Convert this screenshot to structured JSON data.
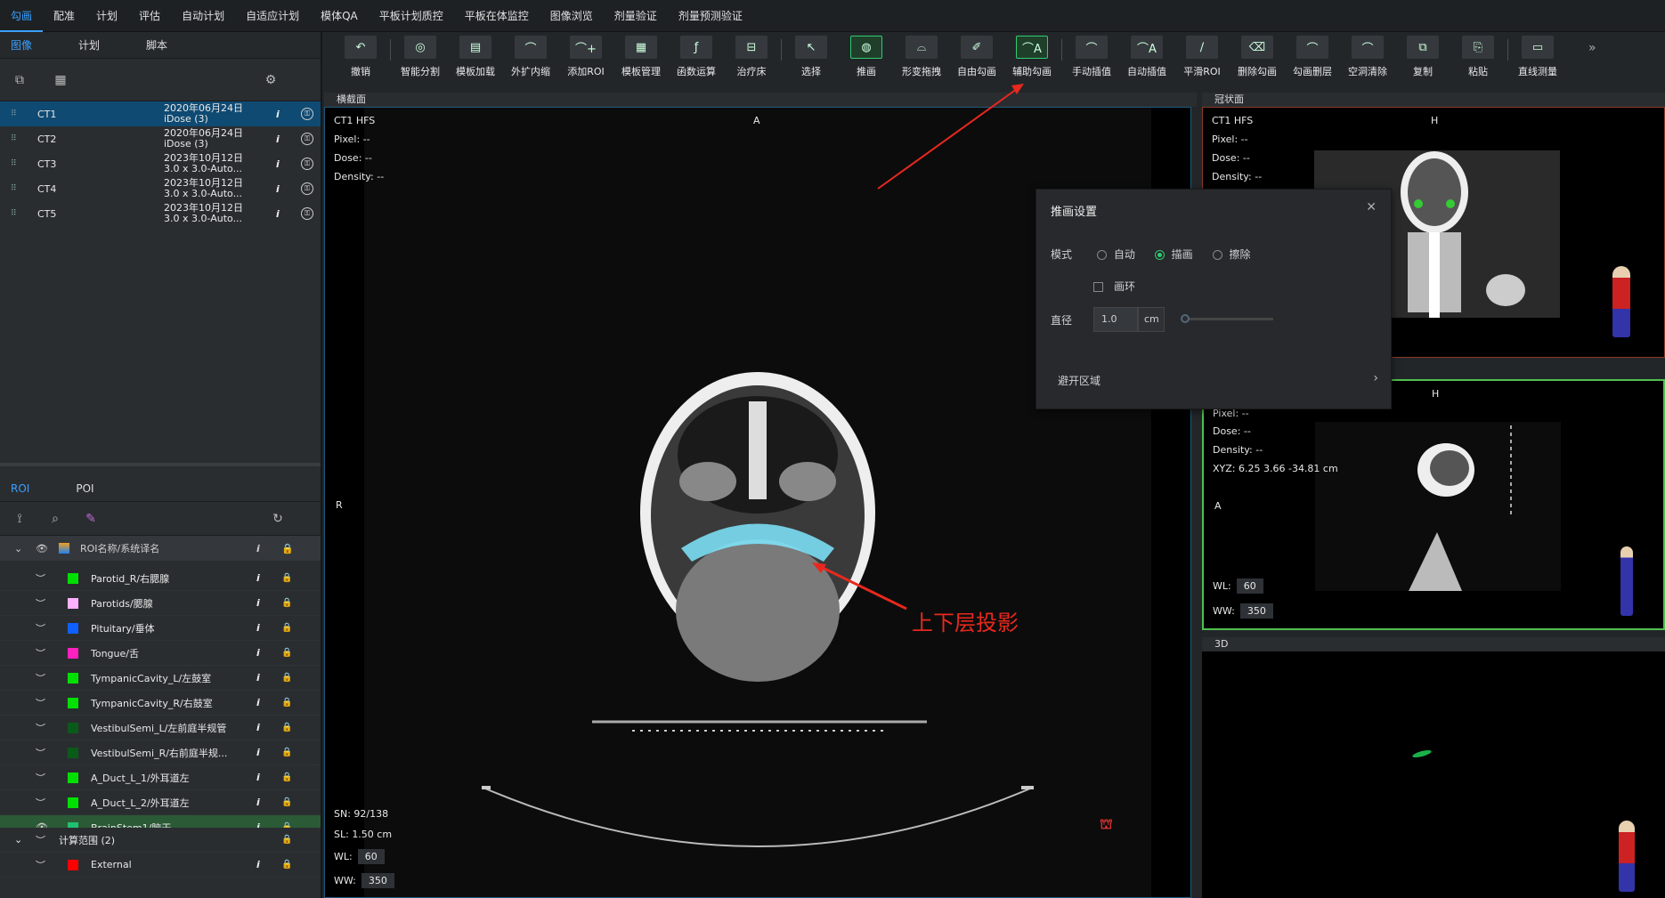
{
  "top_menu": [
    "勾画",
    "配准",
    "计划",
    "评估",
    "自动计划",
    "自适应计划",
    "模体QA",
    "平板计划质控",
    "平板在体监控",
    "图像浏览",
    "剂量验证",
    "剂量预测验证"
  ],
  "left": {
    "tabs": [
      "图像",
      "计划",
      "脚本"
    ],
    "images": [
      {
        "name": "CT1",
        "date": "2020年06月24日",
        "sub": "iDose (3)"
      },
      {
        "name": "CT2",
        "date": "2020年06月24日",
        "sub": "iDose (3)"
      },
      {
        "name": "CT3",
        "date": "2023年10月12日",
        "sub": "3.0 x 3.0-Auto..."
      },
      {
        "name": "CT4",
        "date": "2023年10月12日",
        "sub": "3.0 x 3.0-Auto..."
      },
      {
        "name": "CT5",
        "date": "2023年10月12日",
        "sub": "3.0 x 3.0-Auto..."
      }
    ],
    "info_glyph": "i",
    "roi_tabs": [
      "ROI",
      "POI"
    ],
    "roi_header": "ROI名称/系统译名",
    "rois": [
      {
        "name": "Parotid_R/右腮腺",
        "color": "#00e000"
      },
      {
        "name": "Parotids/腮腺",
        "color": "#ffb0ff"
      },
      {
        "name": "Pituitary/垂体",
        "color": "#1060ff"
      },
      {
        "name": "Tongue/舌",
        "color": "#ff20c0"
      },
      {
        "name": "TympanicCavity_L/左鼓室",
        "color": "#00e000"
      },
      {
        "name": "TympanicCavity_R/右鼓室",
        "color": "#00e000"
      },
      {
        "name": "VestibulSemi_L/左前庭半规管",
        "color": "#0a5a1a"
      },
      {
        "name": "VestibulSemi_R/右前庭半规...",
        "color": "#0a5a1a"
      },
      {
        "name": "A_Duct_L_1/外耳道左",
        "color": "#00e000"
      },
      {
        "name": "A_Duct_L_2/外耳道左",
        "color": "#00e000"
      },
      {
        "name": "BrainStem1/脑干",
        "color": "#20c070"
      }
    ],
    "calc_group": "计算范围 (2)",
    "calc_rois": [
      {
        "name": "External",
        "color": "#ff0000"
      }
    ]
  },
  "toolbar": [
    "撤销",
    "智能分割",
    "模板加载",
    "外扩内缩",
    "添加ROI",
    "模板管理",
    "函数运算",
    "治疗床",
    "选择",
    "推画",
    "形变拖拽",
    "自由勾画",
    "辅助勾画",
    "手动插值",
    "自动插值",
    "平滑ROI",
    "删除勾画",
    "勾画删层",
    "空洞清除",
    "复制",
    "粘贴",
    "直线测量"
  ],
  "views": {
    "axial": {
      "title": "横截面",
      "series": "CT1 HFS",
      "pixel": "Pixel:  --",
      "dose": "Dose:  --",
      "density": "Density:  --",
      "top": "A",
      "left": "R",
      "sn": "SN: 92/138",
      "sl": "SL: 1.50 cm",
      "wl_label": "WL:",
      "wl": "60",
      "ww_label": "WW:",
      "ww": "350"
    },
    "coronal": {
      "title": "冠状面",
      "series": "CT1 HFS",
      "pixel": "Pixel:  --",
      "dose": "Dose:  --",
      "density": "Density:  --",
      "top": "H"
    },
    "sagittal": {
      "pixel": "Pixel:  --",
      "dose": "Dose:  --",
      "density": "Density:  --",
      "xyz": "XYZ: 6.25 3.66 -34.81 cm",
      "top": "H",
      "left": "A",
      "wl_label": "WL:",
      "wl": "60",
      "ww_label": "WW:",
      "ww": "350"
    },
    "3d": {
      "title": "3D"
    }
  },
  "dialog": {
    "title": "推画设置",
    "mode_label": "模式",
    "modes": [
      "自动",
      "描画",
      "擦除"
    ],
    "ring": "画环",
    "diam_label": "直径",
    "diam": "1.0",
    "unit": "cm",
    "avoid": "避开区域"
  },
  "annotation": "上下层投影"
}
